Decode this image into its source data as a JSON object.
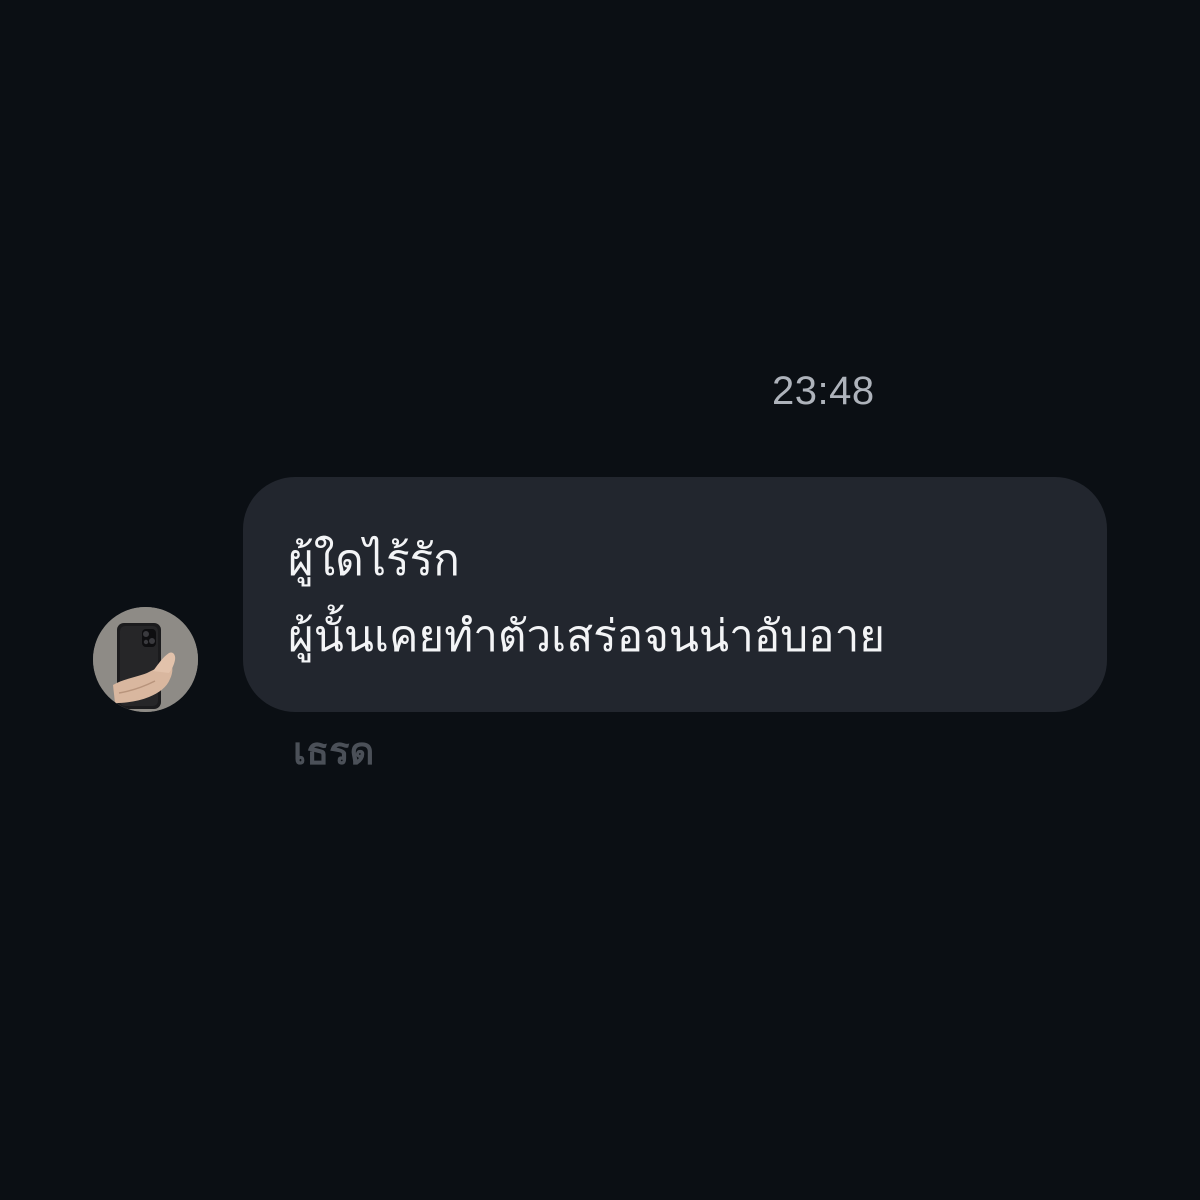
{
  "chat": {
    "timestamp": "23:48",
    "message": {
      "lines": [
        "ผู้ใดไร้รัก",
        "ผู้นั้นเคยทำตัวเสร่อจนน่าอับอาย"
      ],
      "status": "เธรด"
    },
    "sender": {
      "avatar_icon": "profile-photo-hand-holding-phone"
    }
  },
  "colors": {
    "background": "#0b0f14",
    "bubble": "#22262e",
    "text": "#f3f4f6",
    "timestamp": "#aeb3bb",
    "status": "#4b5058"
  }
}
